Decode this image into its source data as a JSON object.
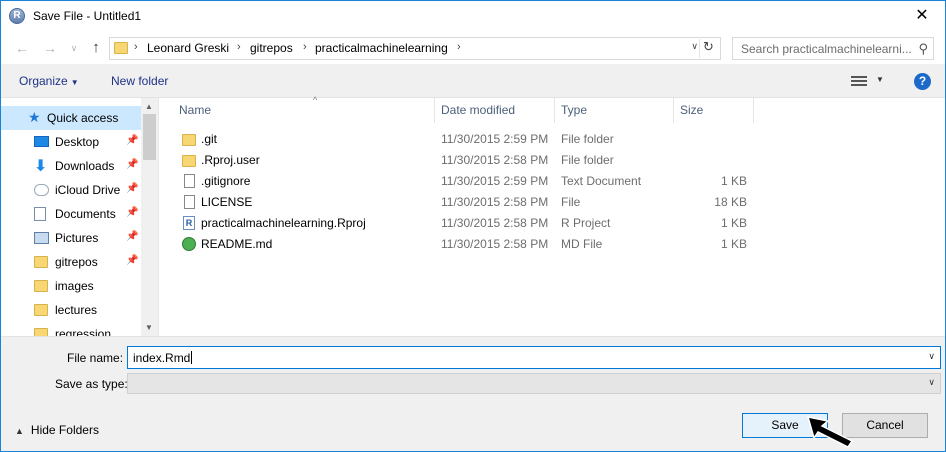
{
  "window": {
    "title": "Save File - Untitled1",
    "app_icon_letter": "R",
    "close_glyph": "✕"
  },
  "nav_buttons": {
    "back": "←",
    "forward": "→",
    "recent": "∨",
    "up": "↑"
  },
  "address": {
    "separator": "›",
    "crumbs": [
      "Leonard Greski",
      "gitrepos",
      "practicalmachinelearning"
    ],
    "dropdown_glyph": "∨",
    "refresh_glyph": "↻"
  },
  "search": {
    "placeholder": "Search practicalmachinelearni...",
    "icon_glyph": "⚲"
  },
  "toolbar": {
    "organize_label": "Organize",
    "organize_caret": "▼",
    "new_folder_label": "New folder",
    "view_caret": "▼",
    "help_label": "?"
  },
  "sidebar": {
    "items": [
      {
        "label": "Quick access",
        "icon": "star-icon",
        "pinned": false
      },
      {
        "label": "Desktop",
        "icon": "desktop-icon",
        "pinned": true
      },
      {
        "label": "Downloads",
        "icon": "download-icon",
        "pinned": true
      },
      {
        "label": "iCloud Drive",
        "icon": "cloud-icon",
        "pinned": true
      },
      {
        "label": "Documents",
        "icon": "documents-icon",
        "pinned": true
      },
      {
        "label": "Pictures",
        "icon": "pictures-icon",
        "pinned": true
      },
      {
        "label": "gitrepos",
        "icon": "folder-icon",
        "pinned": true
      },
      {
        "label": "images",
        "icon": "folder-icon",
        "pinned": false
      },
      {
        "label": "lectures",
        "icon": "folder-icon",
        "pinned": false
      },
      {
        "label": "regression",
        "icon": "folder-icon",
        "pinned": false
      }
    ],
    "star_glyph": "★",
    "download_glyph": "⬇",
    "pin_glyph": "📌",
    "scroll_up_glyph": "▲",
    "scroll_down_glyph": "▼"
  },
  "file_list": {
    "columns": [
      "Name",
      "Date modified",
      "Type",
      "Size"
    ],
    "sort_glyph": "^",
    "files": [
      {
        "name": ".git",
        "date": "11/30/2015 2:59 PM",
        "type": "File folder",
        "size": "",
        "icon": "folder-icon"
      },
      {
        "name": ".Rproj.user",
        "date": "11/30/2015 2:58 PM",
        "type": "File folder",
        "size": "",
        "icon": "folder-icon"
      },
      {
        "name": ".gitignore",
        "date": "11/30/2015 2:59 PM",
        "type": "Text Document",
        "size": "1 KB",
        "icon": "text-document-icon"
      },
      {
        "name": "LICENSE",
        "date": "11/30/2015 2:58 PM",
        "type": "File",
        "size": "18 KB",
        "icon": "file-icon"
      },
      {
        "name": "practicalmachinelearning.Rproj",
        "date": "11/30/2015 2:58 PM",
        "type": "R Project",
        "size": "1 KB",
        "icon": "r-project-icon"
      },
      {
        "name": "README.md",
        "date": "11/30/2015 2:58 PM",
        "type": "MD File",
        "size": "1 KB",
        "icon": "md-file-icon"
      }
    ]
  },
  "save_form": {
    "filename_label": "File name:",
    "filename_value": "index.Rmd",
    "savetype_label": "Save as type:",
    "savetype_value": "",
    "dropdown_glyph": "∨"
  },
  "footer": {
    "hide_folders_label": "Hide Folders",
    "hide_caret": "▲",
    "save_label": "Save",
    "cancel_label": "Cancel"
  },
  "colors": {
    "accent": "#0078d7",
    "selection": "#cce8ff",
    "link_blue": "#1e3287",
    "folder": "#f7d774"
  }
}
